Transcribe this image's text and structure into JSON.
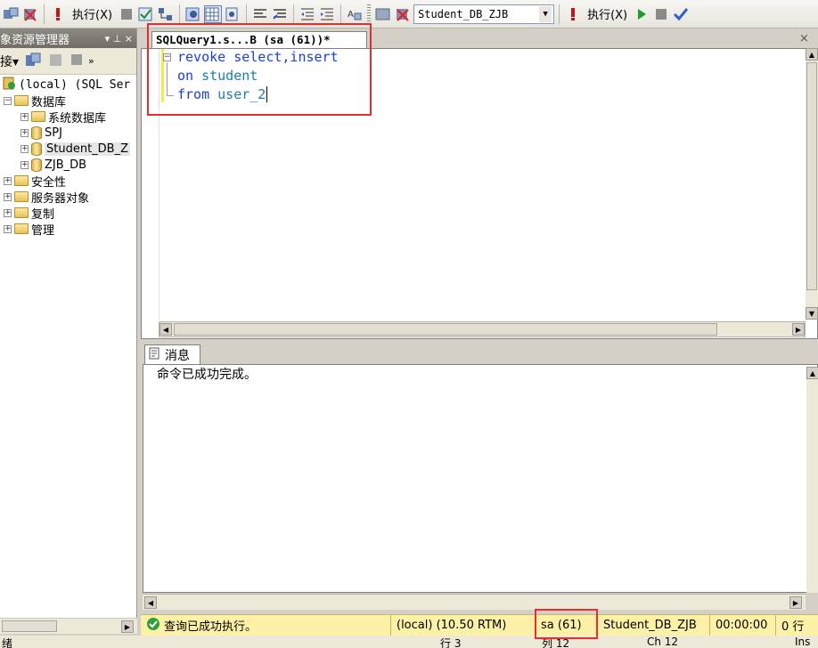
{
  "toolbar": {
    "execute_label": "执行(X)",
    "execute_label_2": "执行(X)",
    "database_selected": "Student_DB_ZJB",
    "execute_color": "#c2161d",
    "run_color": "#1f9b2e",
    "check_color": "#2a62c9"
  },
  "explorer": {
    "title": "象资源管理器",
    "pin_label": "▾ ⊥ ×",
    "connect_label": "接▾",
    "tree": [
      {
        "label": "(local) (SQL Ser",
        "kind": "server",
        "indent": 0,
        "toggle": "-"
      },
      {
        "label": "数据库",
        "kind": "folder",
        "indent": 1,
        "toggle": "-"
      },
      {
        "label": "系统数据库",
        "kind": "folder",
        "indent": 2,
        "toggle": "+"
      },
      {
        "label": "SPJ",
        "kind": "db",
        "indent": 2,
        "toggle": "+"
      },
      {
        "label": "Student_DB_Z",
        "kind": "db",
        "indent": 2,
        "toggle": "+"
      },
      {
        "label": "ZJB_DB",
        "kind": "db",
        "indent": 2,
        "toggle": "+"
      },
      {
        "label": "安全性",
        "kind": "folder",
        "indent": 1,
        "toggle": "+"
      },
      {
        "label": "服务器对象",
        "kind": "folder",
        "indent": 1,
        "toggle": "+"
      },
      {
        "label": "复制",
        "kind": "folder",
        "indent": 1,
        "toggle": "+"
      },
      {
        "label": "管理",
        "kind": "folder",
        "indent": 1,
        "toggle": "+"
      }
    ]
  },
  "editor": {
    "tab_title": "SQLQuery1.s...B (sa (61))*",
    "close_label": "×",
    "lines": [
      {
        "kw": "revoke",
        "rest": " select,insert"
      },
      {
        "kw": "on",
        "rest": " student"
      },
      {
        "kw": "from",
        "rest": " user_2"
      }
    ]
  },
  "results": {
    "tab_label": "消息",
    "message": "命令已成功完成。"
  },
  "status": {
    "query_status": "查询已成功执行。",
    "server": "(local) (10.50 RTM)",
    "user": "sa (61)",
    "database": "Student_DB_ZJB",
    "elapsed": "00:00:00",
    "rows": "0 行"
  },
  "bottom": {
    "ready": "绪",
    "line": "行 3",
    "col": "列 12",
    "ch": "Ch 12",
    "mode": "Ins"
  }
}
